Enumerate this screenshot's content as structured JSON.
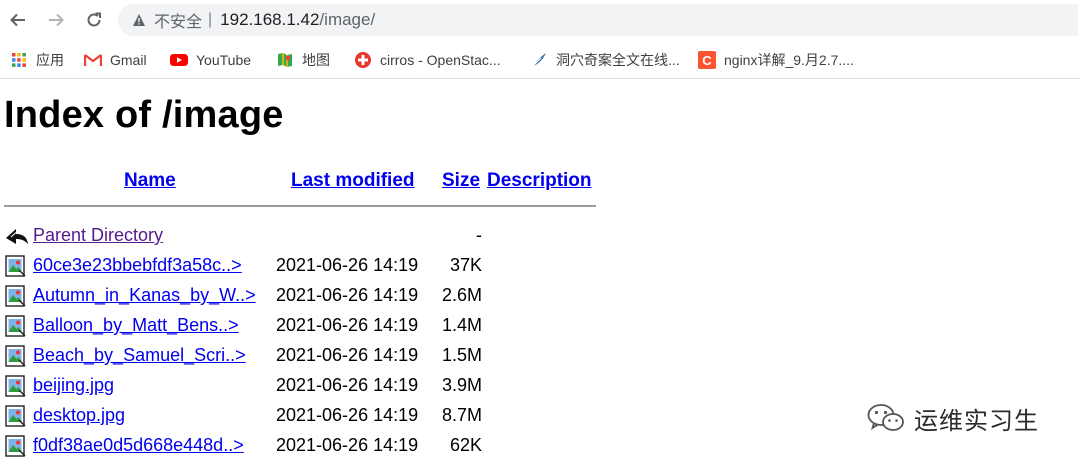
{
  "browser": {
    "insecure_label": "不安全",
    "separator": "|",
    "url_host": "192.168.1.42",
    "url_path": "/image/"
  },
  "bookmarks": [
    {
      "label": "应用",
      "icon": "apps-grid-icon"
    },
    {
      "label": "Gmail",
      "icon": "gmail-icon"
    },
    {
      "label": "YouTube",
      "icon": "youtube-icon"
    },
    {
      "label": "地图",
      "icon": "maps-icon"
    },
    {
      "label": "cirros - OpenStac...",
      "icon": "openstack-icon"
    },
    {
      "label": "洞穴奇案全文在线...",
      "icon": "feather-icon"
    },
    {
      "label": "nginx详解_9.月2.7....",
      "icon": "csdn-icon"
    }
  ],
  "page": {
    "title": "Index of /image",
    "headers": {
      "name": "Name",
      "last_modified": "Last modified",
      "size": "Size",
      "description": "Description"
    },
    "parent": {
      "name": "Parent Directory",
      "size": "-"
    },
    "rows": [
      {
        "name": "60ce3e23bbebfdf3a58c..>",
        "modified": "2021-06-26 14:19",
        "size": "37K"
      },
      {
        "name": "Autumn_in_Kanas_by_W..>",
        "modified": "2021-06-26 14:19",
        "size": "2.6M"
      },
      {
        "name": "Balloon_by_Matt_Bens..>",
        "modified": "2021-06-26 14:19",
        "size": "1.4M"
      },
      {
        "name": "Beach_by_Samuel_Scri..>",
        "modified": "2021-06-26 14:19",
        "size": "1.5M"
      },
      {
        "name": "beijing.jpg",
        "modified": "2021-06-26 14:19",
        "size": "3.9M"
      },
      {
        "name": "desktop.jpg",
        "modified": "2021-06-26 14:19",
        "size": "8.7M"
      },
      {
        "name": "f0df38ae0d5d668e448d..>",
        "modified": "2021-06-26 14:19",
        "size": "62K"
      }
    ]
  },
  "watermark": {
    "text": "运维实习生",
    "icon": "wechat-icon"
  },
  "colors": {
    "link": "#0000ee",
    "visited_link": "#551a8b",
    "warning": "#5f6368"
  }
}
